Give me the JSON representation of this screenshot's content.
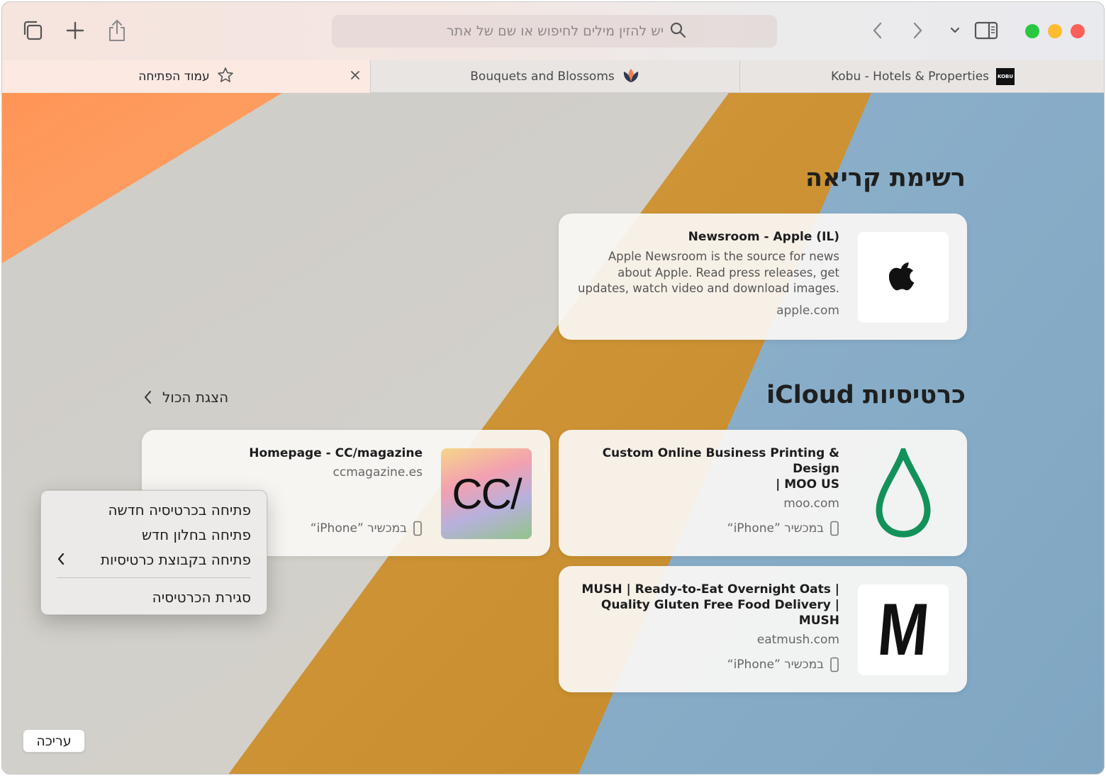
{
  "toolbar": {
    "search_placeholder": "יש להזין מילים לחיפוש או שם של אתר",
    "icons": [
      "show-tabs-icon",
      "new-tab-icon",
      "share-icon",
      "back-icon",
      "forward-icon",
      "chevron-down-icon",
      "sidebar-icon",
      "search-icon"
    ]
  },
  "tabs": [
    {
      "label": "עמוד הפתיחה",
      "icon": "star-icon",
      "active": true
    },
    {
      "label": "Bouquets and Blossoms",
      "icon": "flower-icon",
      "active": false
    },
    {
      "label": "Kobu - Hotels & Properties",
      "icon": "kobu-logo",
      "active": false,
      "icon_text": "KOBU"
    }
  ],
  "reading_list": {
    "title": "רשימת קריאה",
    "items": [
      {
        "title": "Newsroom - Apple (IL)",
        "desc_lines": [
          "Apple Newsroom is the source for news",
          "about Apple. Read press releases, get",
          "updates, watch video and download images."
        ],
        "domain": "apple.com",
        "thumb_icon": "apple-logo-icon"
      }
    ]
  },
  "icloud_tabs": {
    "title": "כרטיסיות iCloud",
    "show_all": "הצגת הכול",
    "items": [
      {
        "title_lines": [
          "Custom Online Business Printing & Design",
          "| MOO US"
        ],
        "domain": "moo.com",
        "device": "במכשיר ”iPhone“",
        "thumb_icon": "moo-drop-logo"
      },
      {
        "title_lines": [
          "Homepage - CC/magazine"
        ],
        "domain": "ccmagazine.es",
        "device": "במכשיר ”iPhone“",
        "thumb_icon": "cc-magazine-logo",
        "thumb_text": "CC/"
      },
      {
        "title_lines": [
          "MUSH | Ready-to-Eat Overnight Oats |",
          "Quality Gluten Free Food Delivery | MUSH"
        ],
        "domain": "eatmush.com",
        "device": "במכשיר ”iPhone“",
        "thumb_icon": "mush-logo",
        "thumb_text": "M"
      }
    ]
  },
  "context_menu": {
    "items": [
      "פתיחה בכרטיסיה חדשה",
      "פתיחה בחלון חדש",
      "פתיחה בקבוצת כרטיסיות",
      "סגירת הכרטיסיה"
    ]
  },
  "edit_button": "עריכה",
  "colors": {
    "orange": "#ff9a5a",
    "gold": "#c88f31",
    "blue": "#87acc6",
    "close": "#fe5f57",
    "minimize": "#febc2e",
    "zoom": "#28c840",
    "moo_green": "#12925a"
  }
}
